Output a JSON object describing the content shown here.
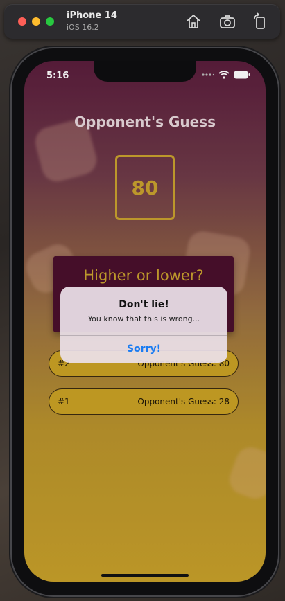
{
  "simulator": {
    "device_name": "iPhone 14",
    "os_version": "iOS 16.2",
    "icons": [
      "home-icon",
      "camera-icon",
      "rotate-icon"
    ]
  },
  "status_bar": {
    "time": "5:16"
  },
  "game": {
    "title": "Opponent's Guess",
    "guess_value": "80",
    "prompt_title": "Higher or lower?"
  },
  "history": [
    {
      "index": "#2",
      "text": "Opponent's Guess: 80"
    },
    {
      "index": "#1",
      "text": "Opponent's Guess: 28"
    }
  ],
  "alert": {
    "title": "Don't lie!",
    "message": "You know that this is wrong...",
    "button_label": "Sorry!"
  },
  "colors": {
    "accent_gold": "#c8a12e",
    "card_bg": "#4a0f2c",
    "alert_button": "#1a7cf2"
  }
}
